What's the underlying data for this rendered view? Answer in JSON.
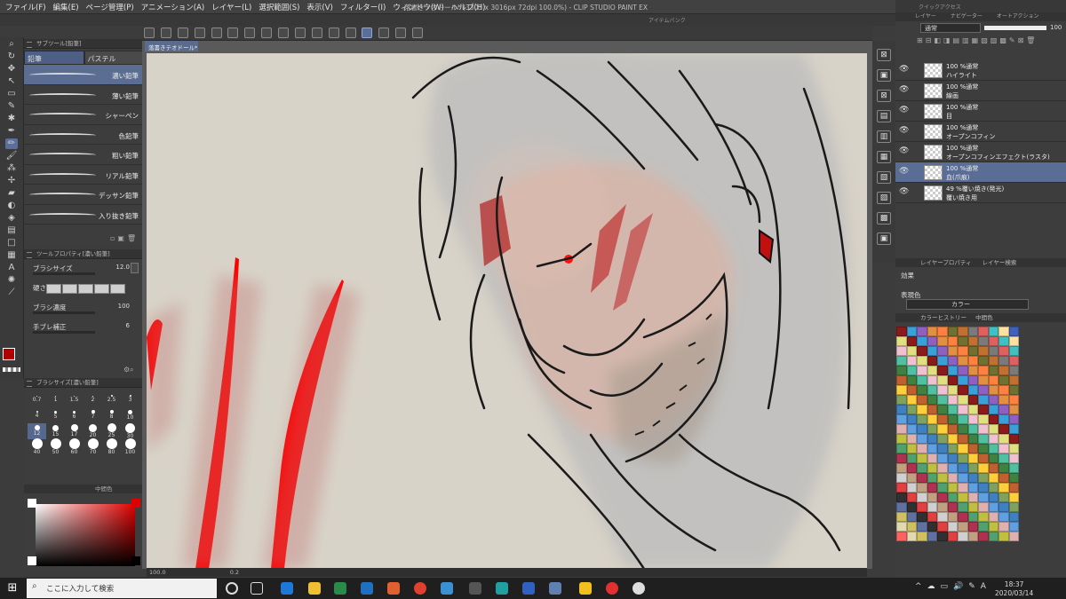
{
  "menu": [
    "ファイル(F)",
    "編集(E)",
    "ページ管理(P)",
    "アニメーション(A)",
    "レイヤー(L)",
    "選択範囲(S)",
    "表示(V)",
    "フィルター(I)",
    "ウィンドウ(W)",
    "ヘルプ(H)"
  ],
  "window_title": "落書きテオドール* (3303 x 3016px 72dpi 100.0%) - CLIP STUDIO PAINT EX",
  "doc_tab": "落書きテオドール*",
  "subtool": {
    "title": "サブツール[鉛筆]",
    "tabs": [
      "鉛筆",
      "パステル"
    ],
    "brushes": [
      "濃い鉛筆",
      "薄い鉛筆",
      "シャーペン",
      "色鉛筆",
      "粗い鉛筆",
      "リアル鉛筆",
      "デッサン鉛筆",
      "入り抜き鉛筆"
    ]
  },
  "tool_property": {
    "title": "ツールプロパティ[濃い鉛筆]",
    "brush_size_label": "ブラシサイズ",
    "brush_size_value": "12.0",
    "hardness_label": "硬さ",
    "density_label": "ブラシ濃度",
    "density_value": "100",
    "stabilization_label": "手ブレ補正",
    "stabilization_value": "6"
  },
  "brush_size_panel": {
    "title": "ブラシサイズ[濃い鉛筆]",
    "sizes": [
      "0.7",
      "1",
      "1.5",
      "2",
      "2.5",
      "3",
      "4",
      "5",
      "6",
      "7",
      "8",
      "10",
      "12",
      "15",
      "17",
      "20",
      "25",
      "30",
      "40",
      "50",
      "60",
      "70",
      "80",
      "100"
    ],
    "selected": "12"
  },
  "color_panel_tab": "中間色",
  "status_zoom": "100.0",
  "status_angle": "0.2",
  "quick_access_tab": "クイックアクセス",
  "item_bank_tab": "アイテムバンク",
  "layer_panel": {
    "tabs": [
      "レイヤー",
      "ナビゲーター",
      "オートアクション"
    ],
    "blend_mode": "通常",
    "opacity": "100",
    "layers": [
      {
        "mode": "100 %通常",
        "name": "ハイライト"
      },
      {
        "mode": "100 %通常",
        "name": "線画"
      },
      {
        "mode": "100 %通常",
        "name": "目"
      },
      {
        "mode": "100 %通常",
        "name": "オープンコフィン"
      },
      {
        "mode": "100 %通常",
        "name": "オープンコフィンエフェクト(ラスタ)"
      },
      {
        "mode": "100 %通常",
        "name": "血(爪痕)"
      },
      {
        "mode": "49 %覆い焼き(発光)",
        "name": "覆い焼き用"
      }
    ],
    "selected_index": 5
  },
  "layer_property": {
    "tabs": [
      "レイヤープロパティ",
      "レイヤー検索"
    ],
    "effect_label": "効果",
    "express_color_label": "表現色",
    "express_color_value": "カラー"
  },
  "color_history_tabs": [
    "カラーヒストリー",
    "中間色"
  ],
  "swatches": [
    "#8b1a1a",
    "#7a7a7a",
    "#c8a060",
    "#6a8aa0",
    "#e2d9b0",
    "#b03050",
    "#ffcf3b",
    "#3aa0d8",
    "#e06060",
    "#aaaaaa",
    "#f0f0f0",
    "#d0c060",
    "#50a070",
    "#c06030",
    "#9060c0",
    "#40c0c0",
    "#ffffff",
    "#d07080",
    "#6070a0",
    "#c0c040",
    "#408040",
    "#e09040",
    "#ffe0a0",
    "#80c0e0",
    "#a0a0a0",
    "#303030",
    "#e0b0b0",
    "#50c0a0",
    "#ff8040",
    "#4060c0",
    "#c0e0a0",
    "#b08050",
    "#e04040",
    "#60a0e0",
    "#f0c0d0",
    "#707030",
    "#ffd040",
    "#80ff80",
    "#8040a0",
    "#d0d0d0",
    "#4080c0",
    "#e0e080",
    "#c07030",
    "#a0d0f0",
    "#605080",
    "#ff6060",
    "#c0a080",
    "#80a060"
  ],
  "taskbar": {
    "search_placeholder": "ここに入力して検索",
    "time": "18:37",
    "date": "2020/03/14",
    "ime": "A"
  }
}
